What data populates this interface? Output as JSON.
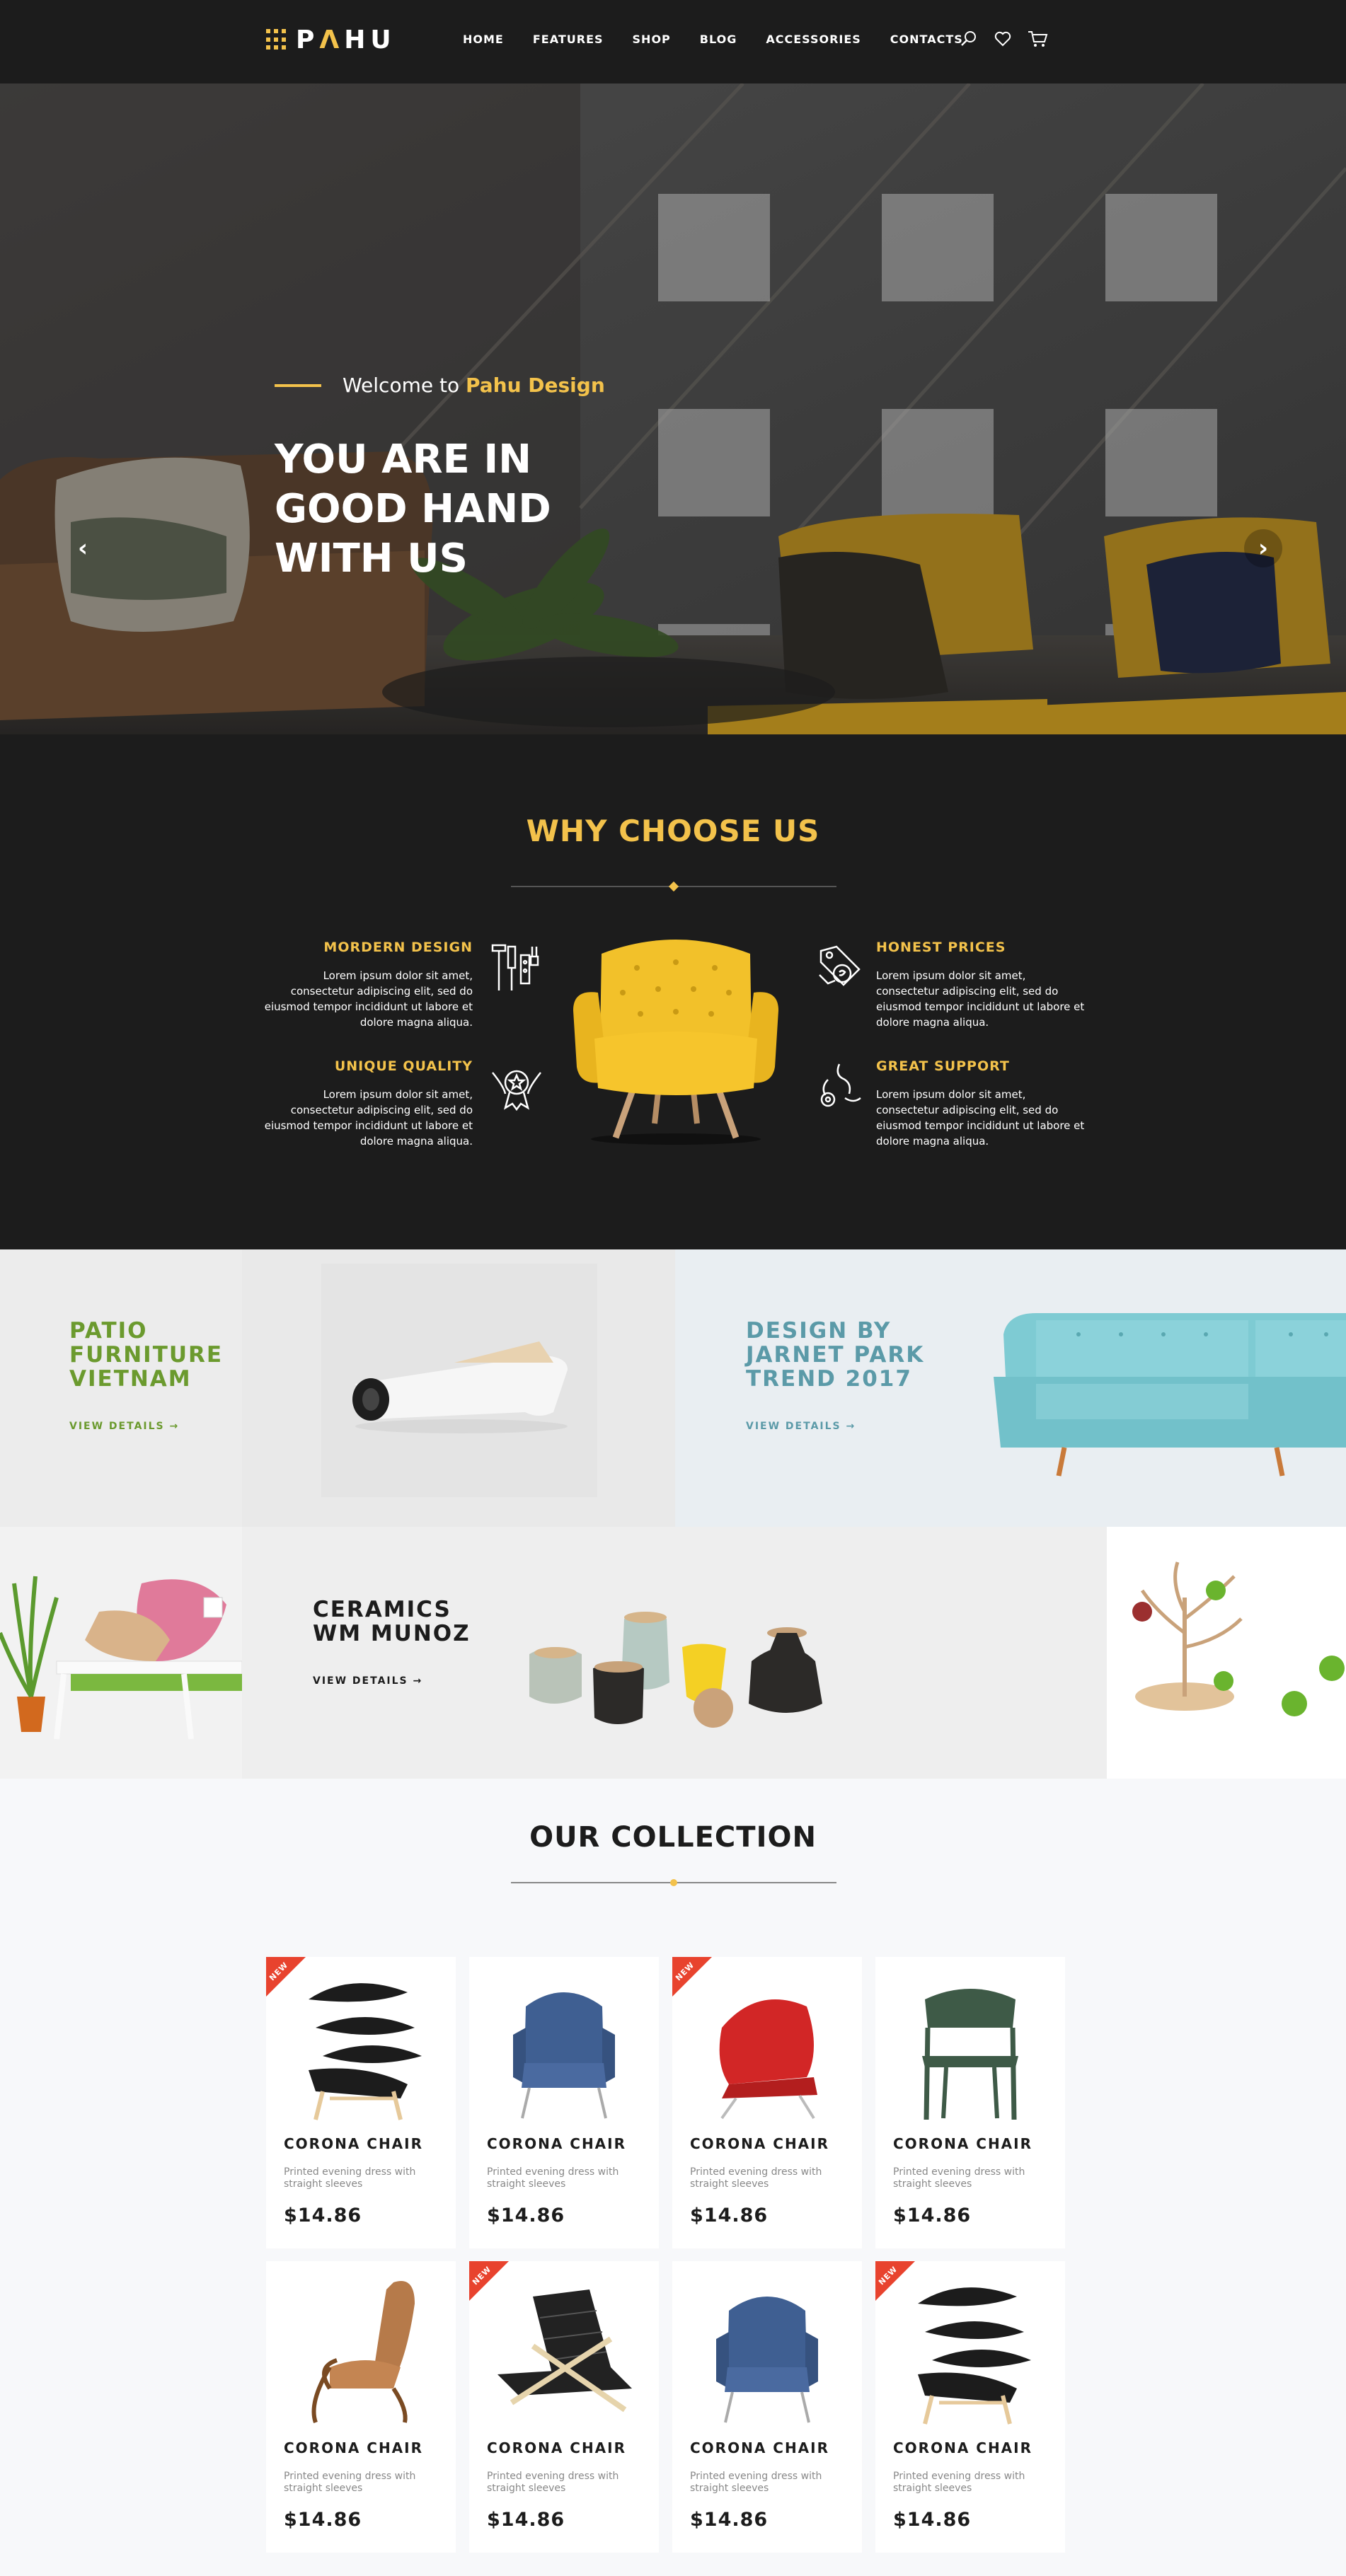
{
  "brand": {
    "logo_main": "PAHU",
    "logo_accent_letter": "A"
  },
  "nav": [
    "HOME",
    "FEATURES",
    "SHOP",
    "BLOG",
    "ACCESSORIES",
    "CONTACTS"
  ],
  "header_icons": [
    "search-icon",
    "heart-icon",
    "cart-icon"
  ],
  "hero": {
    "welcome_prefix": "Welcome to",
    "welcome_accent": "Pahu Design",
    "title": "YOU ARE IN GOOD HAND WITH US",
    "prev_arrow": "‹",
    "next_arrow": "›"
  },
  "why": {
    "title": "WHY CHOOSE US",
    "features": [
      {
        "title": "MORDERN DESIGN",
        "text": "Lorem ipsum dolor sit amet, consectetur adipiscing elit, sed do eiusmod tempor incididunt ut labore et dolore magna aliqua.",
        "icon": "tools-icon"
      },
      {
        "title": "UNIQUE QUALITY",
        "text": "Lorem ipsum dolor sit amet, consectetur adipiscing elit, sed do eiusmod tempor incididunt ut labore et dolore magna aliqua.",
        "icon": "award-badge-icon"
      },
      {
        "title": "HONEST PRICES",
        "text": "Lorem ipsum dolor sit amet, consectetur adipiscing elit, sed do eiusmod tempor incididunt ut labore et dolore magna aliqua.",
        "icon": "price-tag-icon"
      },
      {
        "title": "GREAT SUPPORT",
        "text": "Lorem ipsum dolor sit amet, consectetur adipiscing elit, sed do eiusmod tempor incididunt ut labore et dolore magna aliqua.",
        "icon": "support-gear-icon"
      }
    ]
  },
  "promos": [
    {
      "title": "PATIO FURNITURE VIETNAM",
      "link": "VIEW DETAILS →",
      "color": "#6b9a2e"
    },
    {
      "title": "DESIGN BY JARNET PARK TREND 2017",
      "link": "VIEW DETAILS →",
      "color": "#5b9aa8"
    },
    {
      "title": "CERAMICS WM MUNOZ",
      "link": "VIEW DETAILS →",
      "color": "#1c1c1c"
    }
  ],
  "collection": {
    "title": "OUR COLLECTION",
    "badge_label": "NEW",
    "products": [
      {
        "name": "CORONA CHAIR",
        "desc": "Printed evening dress with straight sleeves",
        "price": "$14.86",
        "is_new": true
      },
      {
        "name": "CORONA CHAIR",
        "desc": "Printed evening dress with straight sleeves",
        "price": "$14.86",
        "is_new": false
      },
      {
        "name": "CORONA CHAIR",
        "desc": "Printed evening dress with straight sleeves",
        "price": "$14.86",
        "is_new": true
      },
      {
        "name": "CORONA CHAIR",
        "desc": "Printed evening dress with straight sleeves",
        "price": "$14.86",
        "is_new": false
      },
      {
        "name": "CORONA CHAIR",
        "desc": "Printed evening dress with straight sleeves",
        "price": "$14.86",
        "is_new": false
      },
      {
        "name": "CORONA CHAIR",
        "desc": "Printed evening dress with straight sleeves",
        "price": "$14.86",
        "is_new": true
      },
      {
        "name": "CORONA CHAIR",
        "desc": "Printed evening dress with straight sleeves",
        "price": "$14.86",
        "is_new": false
      },
      {
        "name": "CORONA CHAIR",
        "desc": "Printed evening dress with straight sleeves",
        "price": "$14.86",
        "is_new": true
      }
    ]
  },
  "colors": {
    "accent": "#f3c24b",
    "dark": "#1c1c1c",
    "badge": "#e8432e"
  }
}
